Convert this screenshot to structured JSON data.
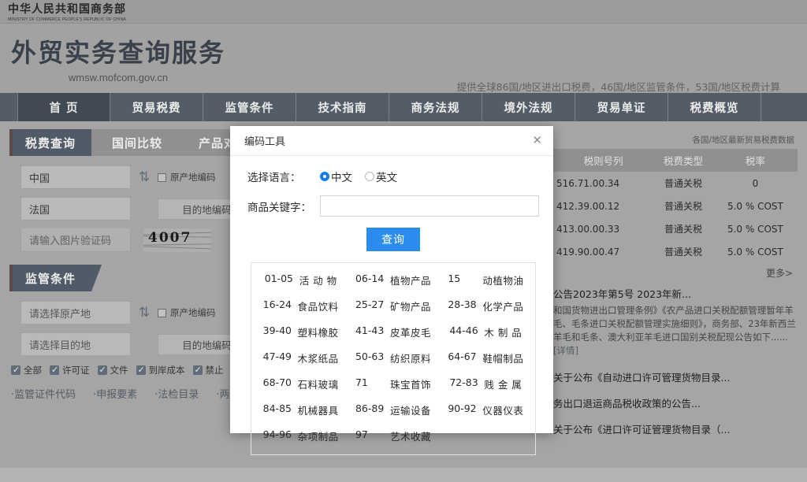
{
  "ministry": {
    "cn": "中华人民共和国商务部",
    "en": "MINISTRY OF COMMERCE PEOPLE'S REPUBLIC OF CHINA"
  },
  "hero": {
    "title": "外贸实务查询服务",
    "url": "wmsw.mofcom.gov.cn",
    "tagline": "提供全球86国/地区进出口税费，46国/地区监管条件，53国/地区税费计算"
  },
  "mainnav": {
    "items": [
      {
        "label": "首 页",
        "active": true
      },
      {
        "label": "贸易税费",
        "active": false
      },
      {
        "label": "监管条件",
        "active": false
      },
      {
        "label": "技术指南",
        "active": false
      },
      {
        "label": "商务法规",
        "active": false
      },
      {
        "label": "境外法规",
        "active": false
      },
      {
        "label": "贸易单证",
        "active": false
      },
      {
        "label": "税费概览",
        "active": false
      }
    ]
  },
  "panel_tax": {
    "tabs": [
      {
        "label": "税费查询",
        "active": true
      },
      {
        "label": "国间比较",
        "active": false
      },
      {
        "label": "产品对比",
        "active": false
      }
    ],
    "origin_value": "中国",
    "dest_value": "法国",
    "origin_code_label": "原产地编码",
    "dest_code_label": "目的地编码",
    "captcha_placeholder": "请输入图片验证码",
    "captcha_text": "4007",
    "swap_icon": "swap-vertical-icon"
  },
  "panel_reg": {
    "tab_label": "监管条件",
    "origin_placeholder": "请选择原产地",
    "dest_placeholder": "请选择目的地",
    "origin_code_label": "原产地编码",
    "dest_code_label": "目的地编码",
    "checkboxes": [
      {
        "label": "全部",
        "checked": true
      },
      {
        "label": "许可证",
        "checked": true
      },
      {
        "label": "文件",
        "checked": true
      },
      {
        "label": "到岸成本",
        "checked": true
      },
      {
        "label": "禁止",
        "checked": true
      }
    ],
    "links": [
      "·监管证件代码",
      "·申报要素",
      "·法检目录",
      "·两反一保案件信息"
    ]
  },
  "right_col": {
    "caption": "各国/地区最新贸易税费数据",
    "table": {
      "headers": [
        "税则号列",
        "税费类型",
        "税率"
      ],
      "rows": [
        {
          "code": "516.71.00.34",
          "type": "普通关税",
          "rate": "0"
        },
        {
          "code": "412.39.00.12",
          "type": "普通关税",
          "rate": "5.0 % COST"
        },
        {
          "code": "413.00.00.33",
          "type": "普通关税",
          "rate": "5.0 % COST"
        },
        {
          "code": "419.90.00.47",
          "type": "普通关税",
          "rate": "5.0 % COST"
        }
      ]
    },
    "more_label": "更多>",
    "news_title": "公告2023年第5号 2023年新...",
    "news_body": "和国货物进出口管理条例》《农产品进口关税配额管理暂年羊毛、毛条进口关税配额管理实施细则》，商务部、23年新西兰羊毛和毛条、澳大利亚羊毛进口国别关税配现公告如下......",
    "news_detail_label": "[详情]",
    "news_list": [
      "关于公布《自动进口许可管理货物目录...",
      "务出口退运商品税收政策的公告...",
      "关于公布《进口许可证管理货物目录（..."
    ]
  },
  "modal": {
    "title": "编码工具",
    "close_icon": "close-icon",
    "language_label": "选择语言：",
    "language_options": [
      {
        "label": "中文",
        "selected": true
      },
      {
        "label": "英文",
        "selected": false
      }
    ],
    "keyword_label": "商品关键字：",
    "keyword_value": "",
    "keyword_placeholder": "",
    "search_button": "查询",
    "categories": [
      {
        "code": "01-05",
        "name": "活 动 物"
      },
      {
        "code": "06-14",
        "name": "植物产品"
      },
      {
        "code": "15",
        "name": "动植物油"
      },
      {
        "code": "16-24",
        "name": "食品饮料"
      },
      {
        "code": "25-27",
        "name": "矿物产品"
      },
      {
        "code": "28-38",
        "name": "化学产品"
      },
      {
        "code": "39-40",
        "name": "塑料橡胶"
      },
      {
        "code": "41-43",
        "name": "皮革皮毛"
      },
      {
        "code": "44-46",
        "name": "木 制 品"
      },
      {
        "code": "47-49",
        "name": "木浆纸品"
      },
      {
        "code": "50-63",
        "name": "纺织原料"
      },
      {
        "code": "64-67",
        "name": "鞋帽制品"
      },
      {
        "code": "68-70",
        "name": "石料玻璃"
      },
      {
        "code": "71",
        "name": "珠宝首饰"
      },
      {
        "code": "72-83",
        "name": "贱 金 属"
      },
      {
        "code": "84-85",
        "name": "机械器具"
      },
      {
        "code": "86-89",
        "name": "运输设备"
      },
      {
        "code": "90-92",
        "name": "仪器仪表"
      },
      {
        "code": "94-96",
        "name": "杂项制品"
      },
      {
        "code": "97",
        "name": "艺术收藏"
      },
      {
        "code": "",
        "name": ""
      }
    ]
  },
  "colors": {
    "nav_blue": "#2b6cb8",
    "nav_active": "#1d5694",
    "title_blue": "#1e4a8f",
    "accent_red": "#c0392b",
    "button_blue": "#2b8cf0",
    "link_blue": "#2b6cb8"
  }
}
